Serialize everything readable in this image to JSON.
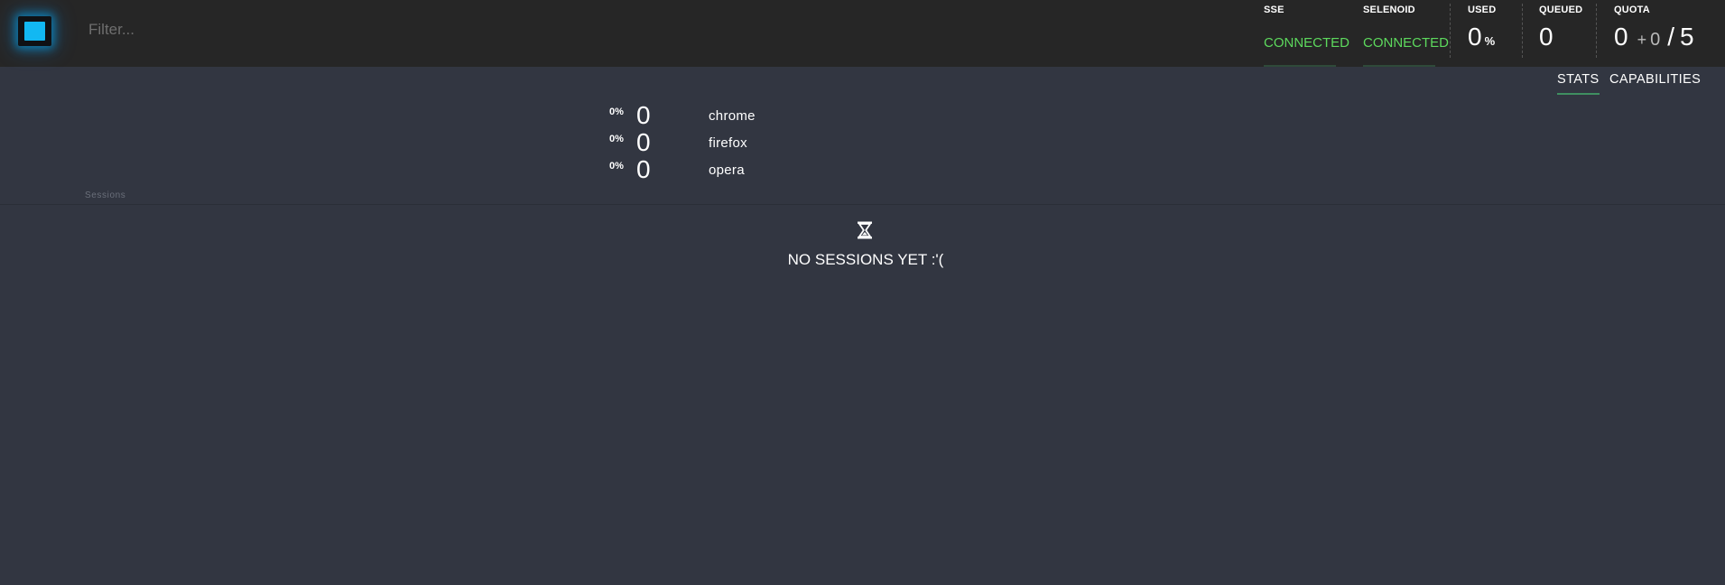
{
  "filter": {
    "placeholder": "Filter..."
  },
  "status": {
    "sse": {
      "label": "SSE",
      "state": "CONNECTED"
    },
    "selenoid": {
      "label": "SELENOID",
      "state": "CONNECTED"
    },
    "used": {
      "label": "USED",
      "value": "0",
      "unit": "%"
    },
    "queued": {
      "label": "QUEUED",
      "value": "0"
    },
    "quota": {
      "label": "QUOTA",
      "used": "0",
      "plus": "+",
      "pending": "0",
      "separator": "/",
      "total": "5"
    }
  },
  "tabs": [
    {
      "label": "STATS",
      "active": true
    },
    {
      "label": "CAPABILITIES",
      "active": false
    }
  ],
  "browsers": [
    {
      "pct": "0%",
      "count": "0",
      "name": "chrome"
    },
    {
      "pct": "0%",
      "count": "0",
      "name": "firefox"
    },
    {
      "pct": "0%",
      "count": "0",
      "name": "opera"
    }
  ],
  "sessions": {
    "caption": "Sessions",
    "empty_icon": "hourglass-icon",
    "empty_text": "NO SESSIONS YET :'("
  },
  "colors": {
    "background": "#323641",
    "topbar": "#262626",
    "connected": "#5dd95d",
    "accent": "#12b8f2",
    "tab_underline": "#3f8f61"
  }
}
